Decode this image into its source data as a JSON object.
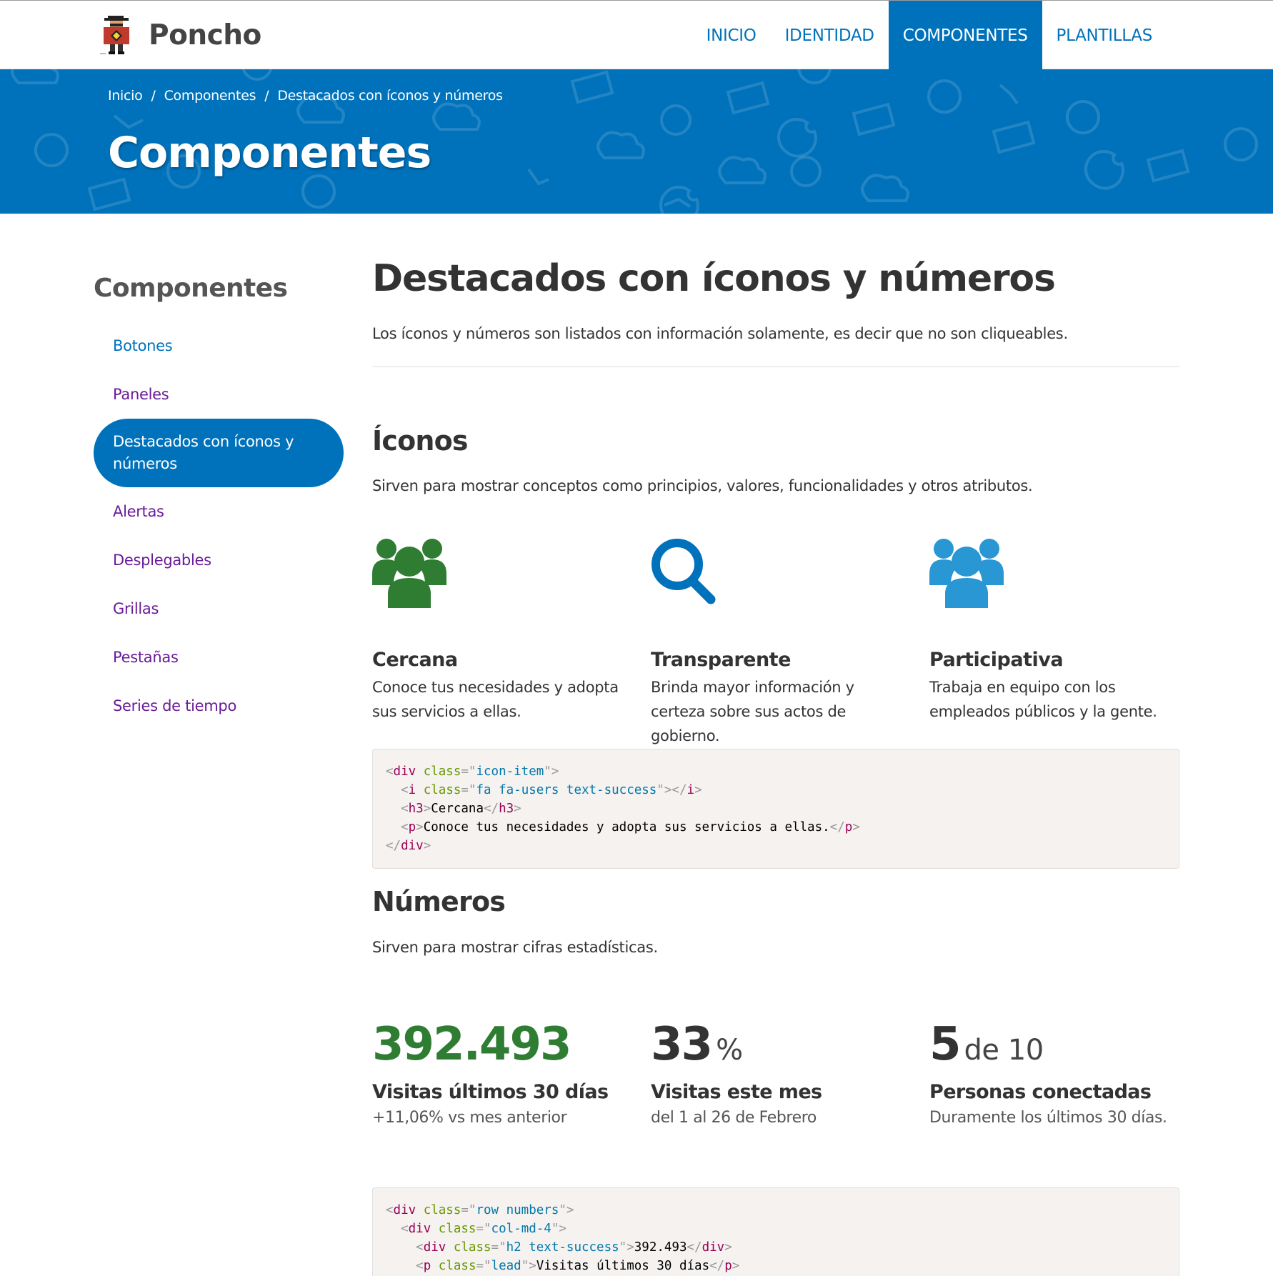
{
  "brand": {
    "name": "Poncho"
  },
  "nav": {
    "items": [
      {
        "label": "INICIO"
      },
      {
        "label": "IDENTIDAD"
      },
      {
        "label": "COMPONENTES"
      },
      {
        "label": "PLANTILLAS"
      }
    ],
    "active_index": 2
  },
  "breadcrumb": {
    "items": [
      "Inicio",
      "Componentes",
      "Destacados con íconos y números"
    ],
    "separator": "/"
  },
  "hero": {
    "title": "Componentes"
  },
  "sidebar": {
    "title": "Componentes",
    "items": [
      {
        "label": "Botones"
      },
      {
        "label": "Paneles"
      },
      {
        "label": "Destacados con íconos y números"
      },
      {
        "label": "Alertas"
      },
      {
        "label": "Desplegables"
      },
      {
        "label": "Grillas"
      },
      {
        "label": "Pestañas"
      },
      {
        "label": "Series de tiempo"
      }
    ],
    "active_index": 2
  },
  "main": {
    "title": "Destacados con íconos y números",
    "intro": "Los íconos y números son listados con información solamente, es decir que no son cliqueables.",
    "icons_section": {
      "heading": "Íconos",
      "description": "Sirven para mostrar conceptos como principios, valores, funcionalidades y otros atributos.",
      "items": [
        {
          "icon": "users-icon",
          "color": "#2e7d32",
          "title": "Cercana",
          "text": "Conoce tus necesidades y adopta sus servicios a ellas."
        },
        {
          "icon": "search-icon",
          "color": "#0072bb",
          "title": "Transparente",
          "text": "Brinda mayor información y certeza sobre sus actos de gobierno."
        },
        {
          "icon": "users-icon",
          "color": "#2897d4",
          "title": "Participativa",
          "text": "Trabaja en equipo con los empleados públicos y la gente."
        }
      ],
      "code": {
        "div_open_tag": "div",
        "div_attr": "class",
        "div_value": "icon-item",
        "i_tag": "i",
        "i_attr": "class",
        "i_value": "fa fa-users text-success",
        "h3_tag": "h3",
        "h3_text": "Cercana",
        "p_tag": "p",
        "p_text": "Conoce tus necesidades y adopta sus servicios a ellas."
      }
    },
    "numbers_section": {
      "heading": "Números",
      "description": "Sirven para mostrar cifras estadísticas.",
      "items": [
        {
          "value": "392.493",
          "unit": "",
          "label": "Visitas últimos 30 días",
          "sub": "+11,06% vs mes anterior"
        },
        {
          "value": "33",
          "unit": "%",
          "label": "Visitas este mes",
          "sub": "del 1 al 26 de Febrero"
        },
        {
          "value": "5",
          "unit": "de 10",
          "label": "Personas conectadas",
          "sub": "Duramente los últimos 30 días."
        }
      ],
      "code": {
        "row_value": "row numbers",
        "col_value": "col-md-4",
        "h2_value": "h2 text-success",
        "h2_text": "392.493",
        "lead_value": "lead",
        "lead_text": "Visitas últimos 30 días"
      }
    }
  },
  "colors": {
    "primary": "#0072bb",
    "success": "#2e7d32",
    "info": "#2897d4",
    "sidebar_link": "#6a1b9a"
  }
}
